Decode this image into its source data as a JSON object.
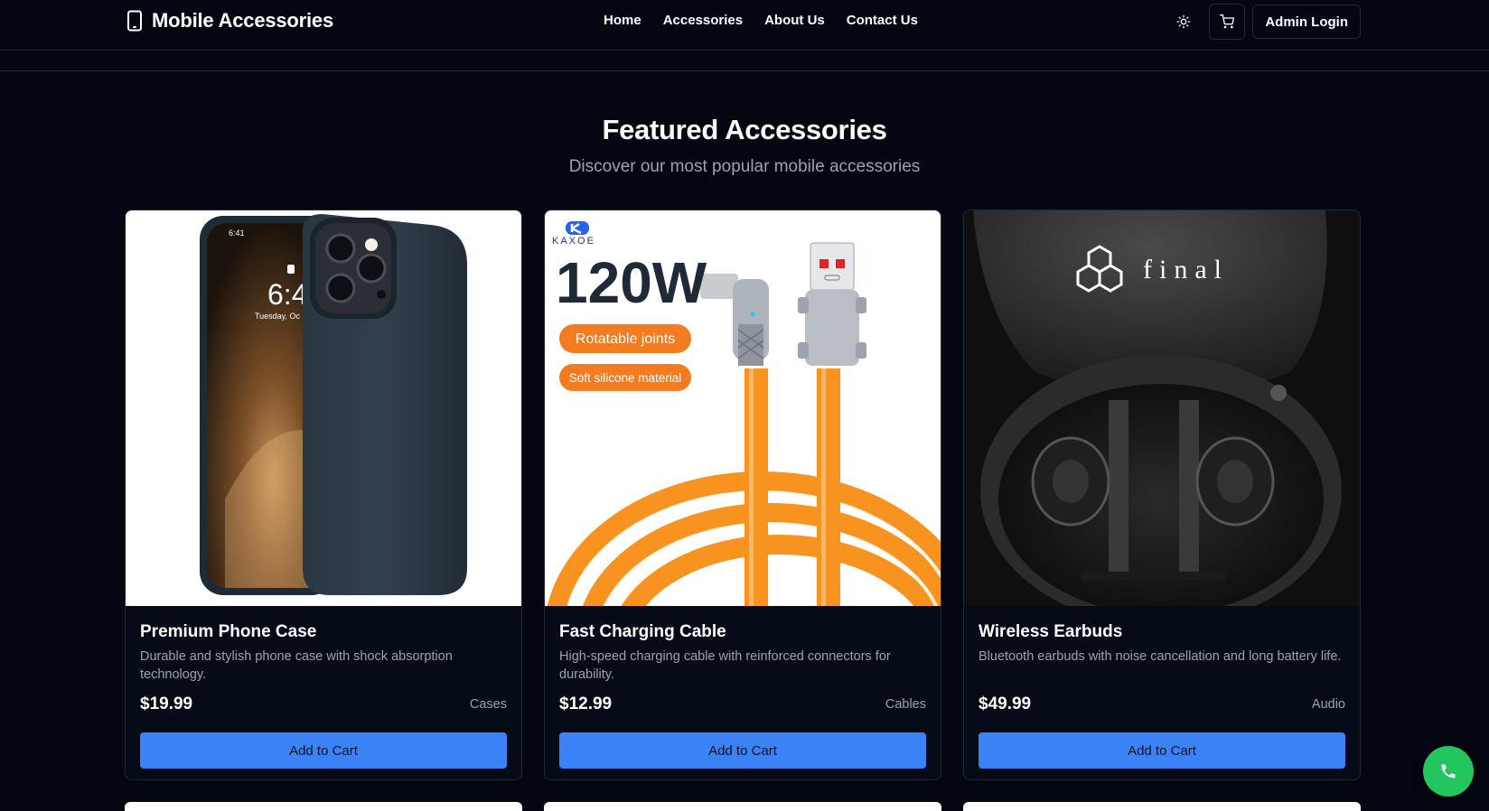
{
  "header": {
    "brand": "Mobile Accessories",
    "nav": [
      "Home",
      "Accessories",
      "About Us",
      "Contact Us"
    ],
    "admin_login": "Admin Login"
  },
  "hero": {
    "title": "Featured Accessories",
    "subtitle": "Discover our most popular mobile accessories"
  },
  "products": [
    {
      "name": "Premium Phone Case",
      "description": "Durable and stylish phone case with shock absorption technology.",
      "price": "$19.99",
      "category": "Cases",
      "button": "Add to Cart",
      "image_text": {
        "time": "6:41",
        "clock": "6:4",
        "date": "Tuesday, Oc"
      }
    },
    {
      "name": "Fast Charging Cable",
      "description": "High-speed charging cable with reinforced connectors for durability.",
      "price": "$12.99",
      "category": "Cables",
      "button": "Add to Cart",
      "image_text": {
        "brand": "KAXOE",
        "wattage": "120W",
        "tag1": "Rotatable joints",
        "tag2": "Soft silicone material"
      }
    },
    {
      "name": "Wireless Earbuds",
      "description": "Bluetooth earbuds with noise cancellation and long battery life.",
      "price": "$49.99",
      "category": "Audio",
      "button": "Add to Cart",
      "image_text": {
        "brand": "final"
      }
    }
  ],
  "colors": {
    "background": "#030712",
    "accent": "#3b82f6",
    "call": "#22c55e",
    "cable_orange": "#f7931e"
  }
}
